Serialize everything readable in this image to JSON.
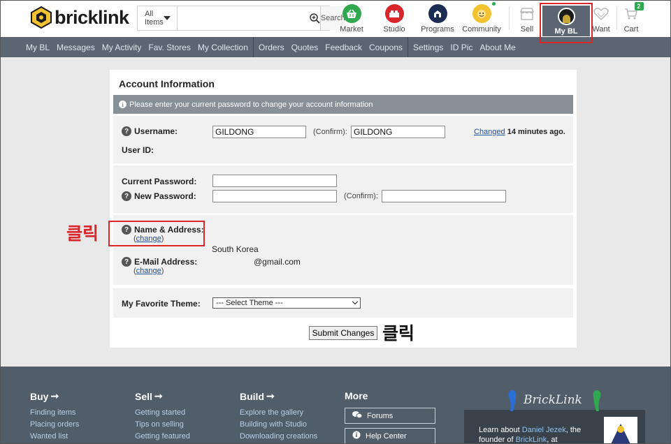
{
  "header": {
    "logo_text": "bricklink",
    "search": {
      "category": "All Items",
      "placeholder": "",
      "button": "Search"
    },
    "nav": [
      {
        "label": "Market",
        "icon": "basket-icon",
        "color": "#2fa84f"
      },
      {
        "label": "Studio",
        "icon": "brick-icon",
        "color": "#d9262a"
      },
      {
        "label": "Programs",
        "icon": "program-icon",
        "color": "#1b2d54"
      },
      {
        "label": "Community",
        "icon": "minifig-face-icon",
        "color": "#f2c230"
      },
      {
        "label": "Sell",
        "icon": "storefront-icon",
        "color": "#b8b8b8"
      },
      {
        "label": "My BL",
        "icon": "avatar-icon",
        "color": "#5b6672"
      },
      {
        "label": "Want",
        "icon": "heart-icon",
        "color": "#b8b8b8"
      },
      {
        "label": "Cart",
        "icon": "cart-icon",
        "color": "#b8b8b8",
        "badge": "2"
      }
    ]
  },
  "subnav": {
    "group1": [
      "My BL",
      "Messages",
      "My Activity",
      "Fav. Stores",
      "My Collection"
    ],
    "group2": [
      "Orders",
      "Quotes",
      "Feedback",
      "Coupons"
    ],
    "group3": [
      "Settings",
      "ID Pic",
      "About Me"
    ]
  },
  "account": {
    "title": "Account Information",
    "notice": "Please enter your current password to change your account information",
    "username_label": "Username:",
    "username_value": "GILDONG",
    "confirm_label": "(Confirm):",
    "username_confirm_value": "GILDONG",
    "changed_link": "Changed",
    "changed_suffix": "14 minutes ago",
    "changed_period": ".",
    "userid_label": "User ID:",
    "current_password_label": "Current Password:",
    "new_password_label": "New Password:",
    "password_confirm_label": "(Confirm):",
    "name_address_label": "Name & Address:",
    "change_link": "change",
    "paren_open": "(",
    "paren_close": ")",
    "country": "South Korea",
    "email_label": "E-Mail Address:",
    "email_value": "@gmail.com",
    "theme_label": "My Favorite Theme:",
    "theme_selected": "--- Select Theme ---",
    "submit": "Submit Changes"
  },
  "annotations": {
    "click_label": "클릭",
    "click_color_red": "#d9262a",
    "click_color_black": "#111111"
  },
  "footer": {
    "buy": {
      "title": "Buy",
      "links": [
        "Finding items",
        "Placing orders",
        "Wanted list"
      ]
    },
    "sell": {
      "title": "Sell",
      "links": [
        "Getting started",
        "Tips on selling",
        "Getting featured"
      ]
    },
    "build": {
      "title": "Build",
      "links": [
        "Explore the gallery",
        "Building with Studio",
        "Downloading creations"
      ]
    },
    "more": {
      "title": "More",
      "buttons": [
        "Forums",
        "Help Center"
      ]
    },
    "promo": {
      "logo": "BrickLink",
      "text_pre": "Learn about ",
      "name": "Daniel Jezek",
      "text_mid": ", the founder of ",
      "brand": "BrickLink",
      "text_post": ", at"
    }
  }
}
